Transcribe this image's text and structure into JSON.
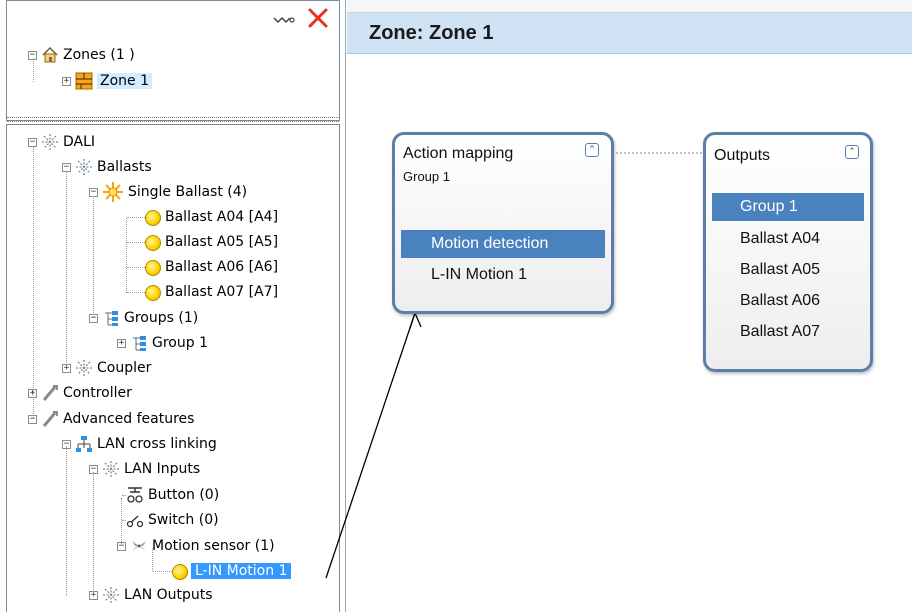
{
  "left_panel": {
    "zones_tree": {
      "root_label": "Zones (1 )",
      "child_label": "Zone 1"
    },
    "device_tree": [
      {
        "label": "DALI",
        "icon": "snowflake-icon"
      },
      {
        "label": "Ballasts",
        "icon": "snowflake-icon"
      },
      {
        "label": "Single Ballast (4)",
        "icon": "sun-icon"
      },
      {
        "label": "Ballast A04 [A4]",
        "icon": "bulb-icon"
      },
      {
        "label": "Ballast A05 [A5]",
        "icon": "bulb-icon"
      },
      {
        "label": "Ballast A06 [A6]",
        "icon": "bulb-icon"
      },
      {
        "label": "Ballast A07 [A7]",
        "icon": "bulb-icon"
      },
      {
        "label": "Groups (1)",
        "icon": "group-icon"
      },
      {
        "label": "Group 1",
        "icon": "group-icon"
      },
      {
        "label": "Coupler",
        "icon": "snowflake-icon"
      },
      {
        "label": "Controller",
        "icon": "wrench-icon"
      },
      {
        "label": "Advanced features",
        "icon": "wrench-icon"
      },
      {
        "label": "LAN cross linking",
        "icon": "network-icon"
      },
      {
        "label": "LAN Inputs",
        "icon": "snowflake-icon"
      },
      {
        "label": "Button (0)",
        "icon": "button-icon"
      },
      {
        "label": "Switch (0)",
        "icon": "switch-icon"
      },
      {
        "label": "Motion sensor (1)",
        "icon": "fan-icon"
      },
      {
        "label": "L-IN Motion 1",
        "icon": "bulb-icon"
      },
      {
        "label": "LAN Outputs",
        "icon": "snowflake-icon"
      }
    ]
  },
  "header": {
    "title": "Zone: Zone 1"
  },
  "canvas": {
    "action_node": {
      "title": "Action mapping",
      "subtitle": "Group 1",
      "items": [
        "Motion detection",
        "L-IN Motion 1"
      ],
      "highlighted_index": 0
    },
    "outputs_node": {
      "title": "Outputs",
      "items": [
        "Group 1",
        "Ballast A04",
        "Ballast A05",
        "Ballast A06",
        "Ballast A07"
      ],
      "highlighted_index": 0
    }
  },
  "colors": {
    "node_border": "#5b7fa8",
    "highlight": "#4a82c0",
    "tree_selection": "#3399ff",
    "header_bg": "#cfe3f5"
  }
}
